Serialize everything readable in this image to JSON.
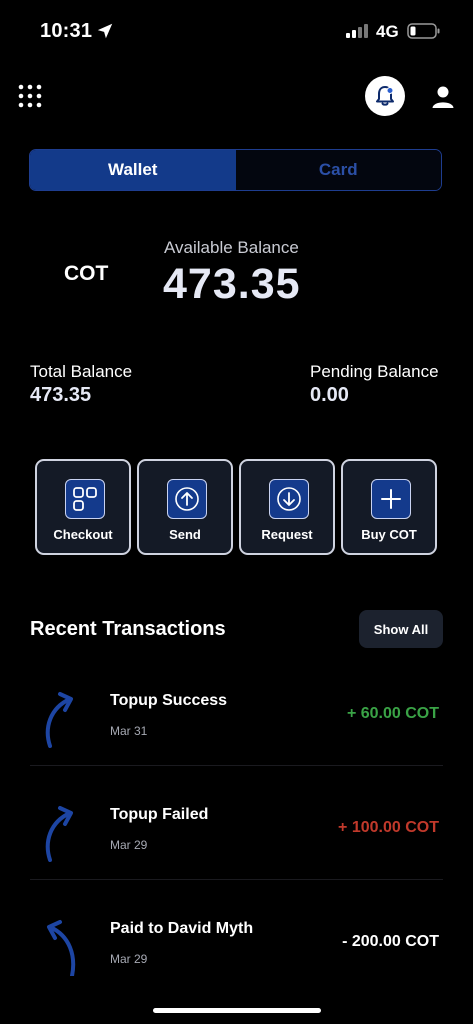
{
  "status": {
    "time": "10:31",
    "network": "4G"
  },
  "icons": {
    "menu": "grid-dots-icon",
    "notifications": "bell-icon",
    "profile": "user-icon",
    "checkout": "grid-squares-icon",
    "send": "arrow-up-icon",
    "request": "arrow-down-icon",
    "buy": "plus-icon"
  },
  "tabs": [
    {
      "label": "Wallet",
      "active": true
    },
    {
      "label": "Card",
      "active": false
    }
  ],
  "balance": {
    "currency": "COT",
    "available_label": "Available Balance",
    "available_amount": "473.35",
    "total_label": "Total Balance",
    "total_value": "473.35",
    "pending_label": "Pending Balance",
    "pending_value": "0.00"
  },
  "actions": [
    {
      "label": "Checkout"
    },
    {
      "label": "Send"
    },
    {
      "label": "Request"
    },
    {
      "label": "Buy COT"
    }
  ],
  "transactions_section": {
    "title": "Recent Transactions",
    "show_all_label": "Show All"
  },
  "transactions": [
    {
      "title": "Topup Success",
      "date": "Mar 31",
      "amount": "+ 60.00 COT",
      "direction": "incoming",
      "color": "#3aa346"
    },
    {
      "title": "Topup Failed",
      "date": "Mar 29",
      "amount": "+ 100.00 COT",
      "direction": "incoming",
      "color": "#c1392b"
    },
    {
      "title": "Paid to David Myth",
      "date": "Mar 29",
      "amount": "- 200.00 COT",
      "direction": "outgoing",
      "color": "#ffffff"
    }
  ],
  "colors": {
    "accent": "#133a8a",
    "accent_text": "#2b4fa6",
    "arrow": "#1d45a3",
    "background": "#000000"
  }
}
